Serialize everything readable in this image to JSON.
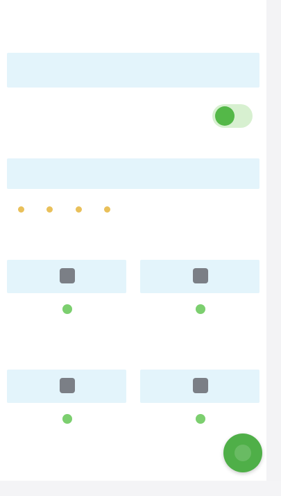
{
  "header": {
    "link_text": ""
  },
  "section_one": {
    "title": ""
  },
  "toggle_row": {
    "label": "",
    "enabled": true
  },
  "section_two": {
    "title": ""
  },
  "chips": [
    {
      "label": ""
    },
    {
      "label": ""
    },
    {
      "label": ""
    },
    {
      "label": ""
    },
    {
      "label": ""
    }
  ],
  "view_more": "",
  "cards": [
    {
      "label": "",
      "icon": "square-icon"
    },
    {
      "label": "",
      "icon": "square-icon"
    },
    {
      "label": "",
      "icon": "square-icon"
    },
    {
      "label": "",
      "icon": "square-icon"
    }
  ],
  "fab": {
    "icon": "add-icon"
  },
  "colors": {
    "accent_green": "#4faf48",
    "banner_blue": "#e3f4fb",
    "link_blue": "#6b75d9"
  }
}
